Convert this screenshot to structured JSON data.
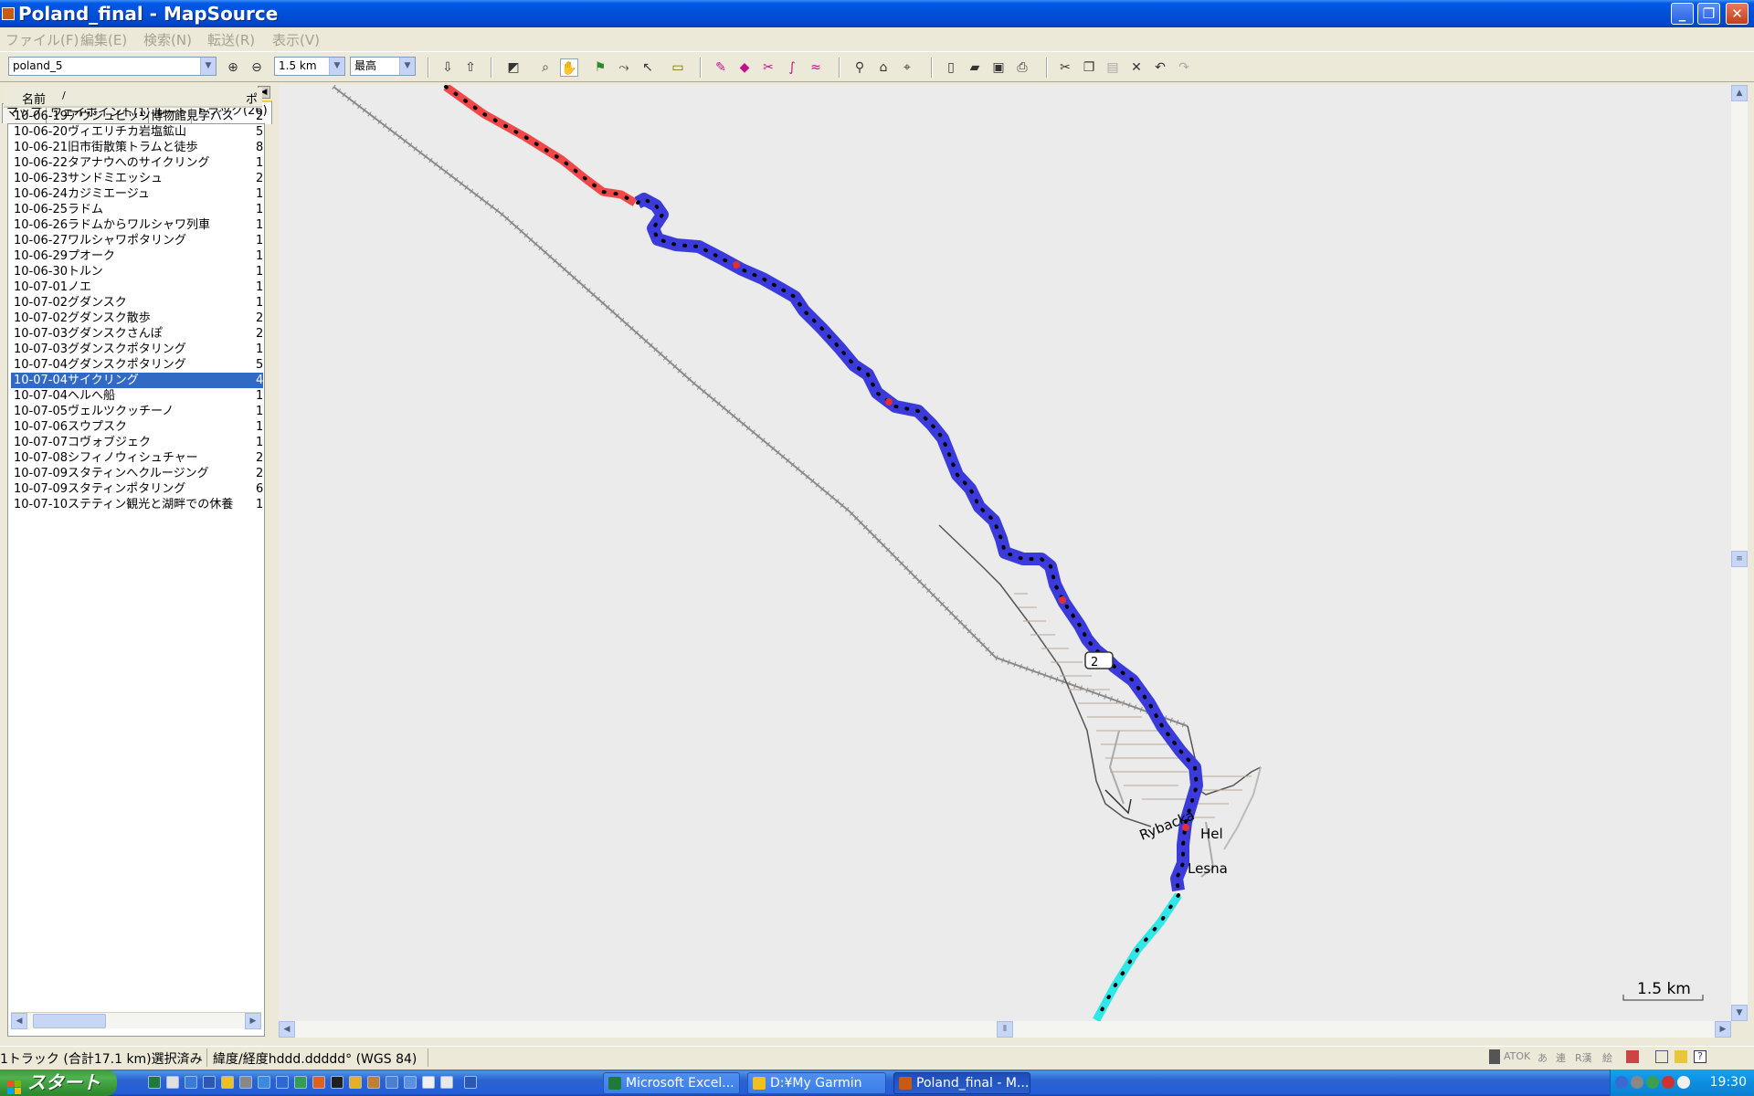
{
  "window": {
    "title": "Poland_final - MapSource",
    "minimize": "_",
    "maximize": "❐",
    "close": "✕"
  },
  "menu": {
    "items": [
      "ファイル(F)",
      "編集(E)",
      "検索(N)",
      "転送(R)",
      "表示(V)"
    ]
  },
  "toolbar": {
    "map_product": "poland_5",
    "zoom_scale": "1.5 km",
    "detail_level": "最高"
  },
  "left_pane": {
    "tabs": [
      "マップ",
      "ウェイポイント(1)",
      "ルート",
      "トラック(26)"
    ],
    "active_tab_index": 3,
    "columns": [
      "名前",
      "/",
      "ポ"
    ],
    "tracks": [
      {
        "name": "10-06-19アウシュビッツ博物館見学バス",
        "points": "2"
      },
      {
        "name": "10-06-20ヴィエリチカ岩塩鉱山",
        "points": "5"
      },
      {
        "name": "10-06-21旧市街散策トラムと徒歩",
        "points": "8"
      },
      {
        "name": "10-06-22タアナウへのサイクリング",
        "points": "1"
      },
      {
        "name": "10-06-23サンドミエッシュ",
        "points": "2"
      },
      {
        "name": "10-06-24カジミエージュ",
        "points": "1"
      },
      {
        "name": "10-06-25ラドム",
        "points": "1"
      },
      {
        "name": "10-06-26ラドムからワルシャワ列車",
        "points": "1"
      },
      {
        "name": "10-06-27ワルシャワポタリング",
        "points": "1"
      },
      {
        "name": "10-06-29プオーク",
        "points": "1"
      },
      {
        "name": "10-06-30トルン",
        "points": "1"
      },
      {
        "name": "10-07-01ノエ",
        "points": "1"
      },
      {
        "name": "10-07-02グダンスク",
        "points": "1"
      },
      {
        "name": "10-07-02グダンスク散歩",
        "points": "2"
      },
      {
        "name": "10-07-03グダンスクさんぽ",
        "points": "2"
      },
      {
        "name": "10-07-03グダンスクポタリング",
        "points": "1"
      },
      {
        "name": "10-07-04グダンスクポタリング",
        "points": "5"
      },
      {
        "name": "10-07-04サイクリング",
        "points": "4"
      },
      {
        "name": "10-07-04ヘルへ船",
        "points": "1"
      },
      {
        "name": "10-07-05ヴェルツクッチーノ",
        "points": "1"
      },
      {
        "name": "10-07-06スウプスク",
        "points": "1"
      },
      {
        "name": "10-07-07コヴォブジェク",
        "points": "1"
      },
      {
        "name": "10-07-08シフィノウィシュチャー",
        "points": "2"
      },
      {
        "name": "10-07-09スタティンへクルージング",
        "points": "2"
      },
      {
        "name": "10-07-09スタティンポタリング",
        "points": "6"
      },
      {
        "name": "10-07-10ステティン観光と湖畔での休養",
        "points": "1"
      }
    ],
    "selected_index": 17
  },
  "map": {
    "labels": {
      "rybacka": "Rybacka",
      "hel": "Hel",
      "lesna": "Lesna",
      "road_shield": "2"
    },
    "scale": "1.5 km",
    "colors": {
      "background": "#ebebeb",
      "selected_track": "#3b3bdc",
      "red_track": "#f04848",
      "cyan_track": "#2ee8e8",
      "railway": "#8a8a8a"
    }
  },
  "status": {
    "selection": "1トラック (合計17.1 km)選択済み",
    "coords": "緯度/経度hddd.ddddd° (WGS 84)",
    "ime": [
      "ATOK",
      "あ",
      "連",
      "R漢",
      "絵"
    ]
  },
  "taskbar": {
    "start": "スタート",
    "tasks": [
      {
        "label": "Microsoft Excel...",
        "active": false
      },
      {
        "label": "D:¥My Garmin",
        "active": false
      },
      {
        "label": "Poland_final - M...",
        "active": true
      }
    ],
    "clock": "19:30"
  }
}
